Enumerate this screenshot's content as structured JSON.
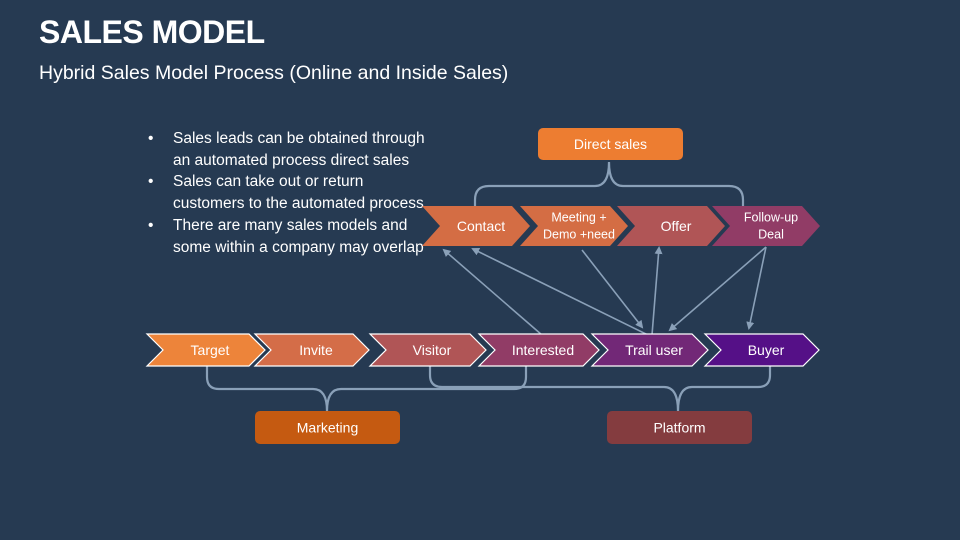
{
  "title": "SALES MODEL",
  "subtitle": "Hybrid Sales Model Process (Online and Inside Sales)",
  "bullets": [
    "Sales leads can be obtained through an automated process direct sales",
    "Sales can take out or return customers to the automated process.",
    "There are many sales models and some within a company may overlap"
  ],
  "direct_sales": {
    "label": "Direct sales",
    "color": "#ed7d31",
    "steps": [
      {
        "id": "contact",
        "lines": [
          "Contact"
        ],
        "color": "#d46d44"
      },
      {
        "id": "meeting",
        "lines": [
          "Meeting +",
          "Demo +need"
        ],
        "color": "#d46d44"
      },
      {
        "id": "offer",
        "lines": [
          "Offer"
        ],
        "color": "#b05556"
      },
      {
        "id": "followup",
        "lines": [
          "Follow-up",
          "Deal"
        ],
        "color": "#913c66"
      }
    ]
  },
  "online_funnel": {
    "steps": [
      {
        "id": "target",
        "label": "Target",
        "color": "#ed843a"
      },
      {
        "id": "invite",
        "label": "Invite",
        "color": "#d46d48"
      },
      {
        "id": "visitor",
        "label": "Visitor",
        "color": "#b05556"
      },
      {
        "id": "interested",
        "label": "Interested",
        "color": "#913c66"
      },
      {
        "id": "trail_user",
        "label": "Trail user",
        "color": "#722877"
      },
      {
        "id": "buyer",
        "label": "Buyer",
        "color": "#551087"
      }
    ]
  },
  "groups": {
    "marketing": {
      "label": "Marketing",
      "color": "#c55a11",
      "spans": [
        "target",
        "interested"
      ]
    },
    "platform": {
      "label": "Platform",
      "color": "#843c3f",
      "spans": [
        "visitor",
        "buyer"
      ]
    }
  },
  "connections": [
    {
      "from": "interested",
      "to": "contact"
    },
    {
      "from": "trail_user",
      "to": "contact"
    },
    {
      "from": "meeting",
      "to": "trail_user"
    },
    {
      "from": "trail_user",
      "to": "offer"
    },
    {
      "from": "followup",
      "to": "trail_user"
    },
    {
      "from": "followup",
      "to": "buyer"
    }
  ],
  "colors": {
    "background": "#263a52",
    "connector": "#8aa0b8"
  }
}
